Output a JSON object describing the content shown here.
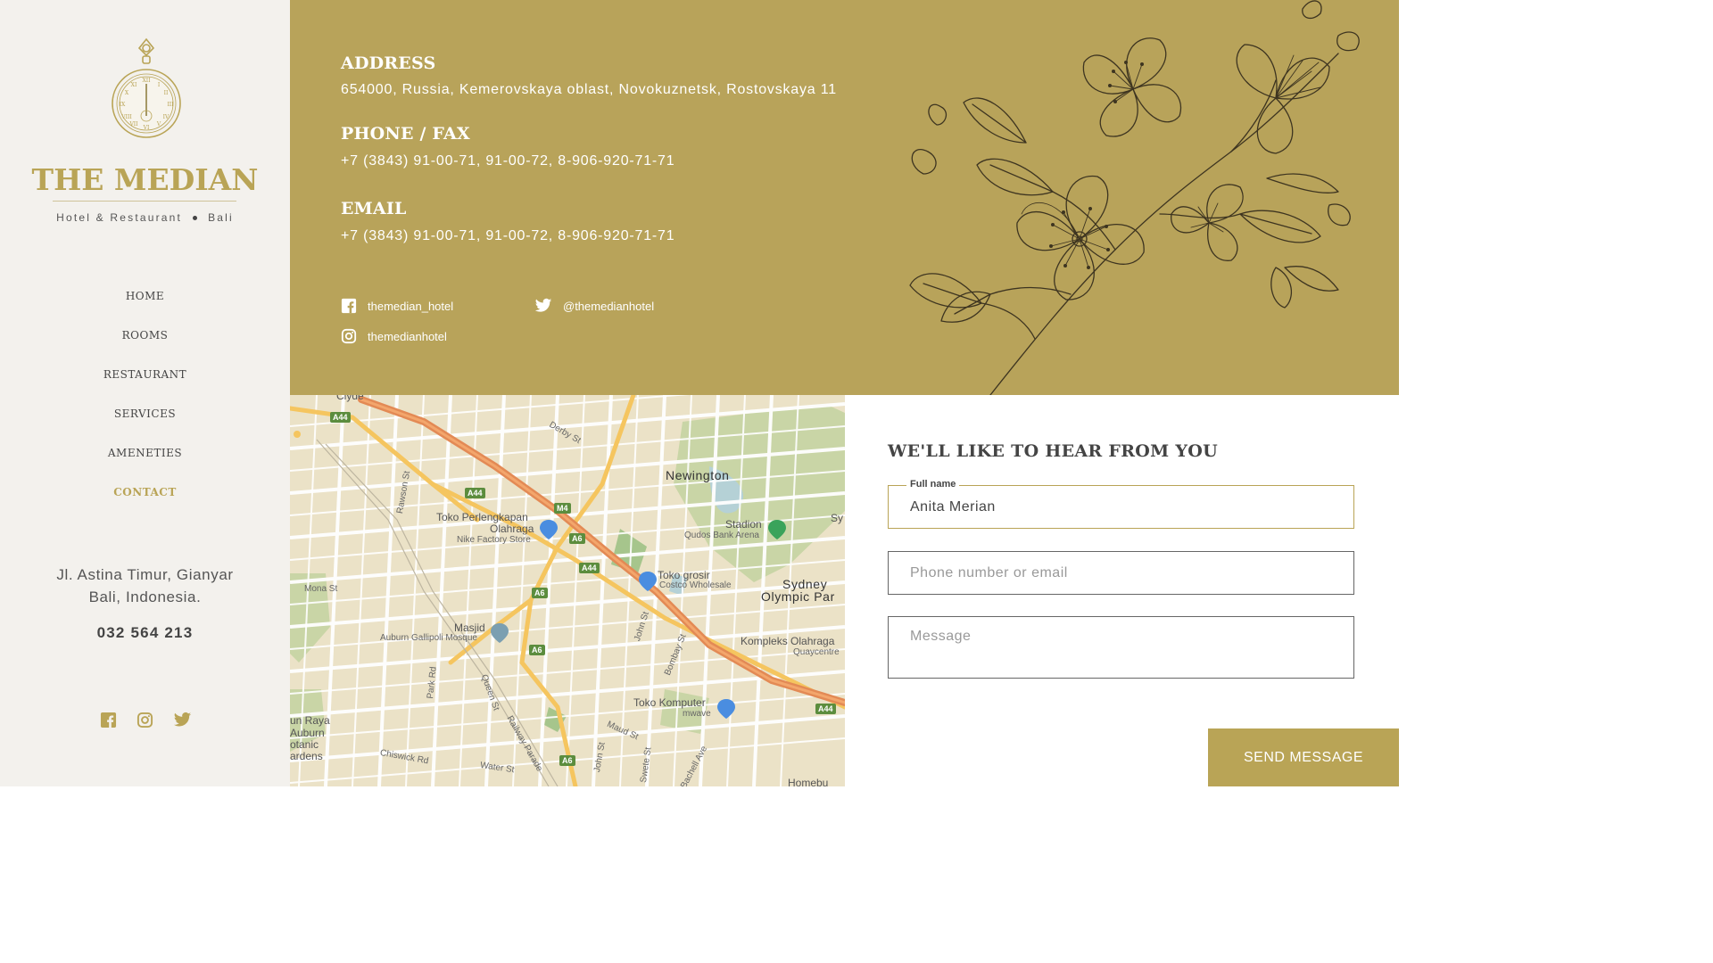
{
  "brand": {
    "name": "THE MEDIAN",
    "subtitle_left": "Hotel & Restaurant",
    "subtitle_right": "Bali",
    "accent_color": "#b9a456"
  },
  "nav": {
    "items": [
      {
        "label": "HOME",
        "active": false
      },
      {
        "label": "ROOMS",
        "active": false
      },
      {
        "label": "RESTAURANT",
        "active": false
      },
      {
        "label": "SERVICES",
        "active": false
      },
      {
        "label": "AMENETIES",
        "active": false
      },
      {
        "label": "CONTACT",
        "active": true
      }
    ]
  },
  "sidebar": {
    "address_line1": "Jl. Astina Timur, Gianyar",
    "address_line2": "Bali, Indonesia.",
    "phone": "032 564 213",
    "social_icons": [
      "facebook-icon",
      "instagram-icon",
      "twitter-icon"
    ]
  },
  "contact": {
    "address_label": "ADDRESS",
    "address_value": "654000, Russia, Kemerovskaya oblast, Novokuznetsk, Rostovskaya 11",
    "phone_label": "PHONE / FAX",
    "phone_value": "+7 (3843) 91-00-71, 91-00-72, 8-906-920-71-71",
    "email_label": "EMAIL",
    "email_value": "+7 (3843) 91-00-71, 91-00-72, 8-906-920-71-71",
    "facebook": "themedian_hotel",
    "twitter": "@themedianhotel",
    "instagram": "themedianhotel",
    "block_color": "#b8a35a"
  },
  "map": {
    "labels": {
      "clyde": "Clyde",
      "derby": "Derby St",
      "newington": "Newington",
      "rawson": "Rawson St",
      "toko1a": "Toko Perlengkapan",
      "toko1b": "Olahraga",
      "nike": "Nike Factory Store",
      "stadion": "Stadion",
      "qudos": "Qudos Bank Arena",
      "sydney1": "Sydney",
      "sydney2": "Olympic Par",
      "toko2": "Toko grosir",
      "costco": "Costco Wholesale",
      "mona": "Mona St",
      "masjid": "Masjid",
      "auburn_mosque": "Auburn Gallipoli Mosque",
      "john1": "John St",
      "bombay": "Bombay St",
      "kompleks": "Kompleks Olahraga",
      "quay": "Quaycentre",
      "park": "Park Rd",
      "queen": "Queen St",
      "railway": "Railway Parade",
      "toko3": "Toko Komputer",
      "jbhifi": "mwave",
      "maud": "Maud St",
      "auburn1": "un Raya",
      "auburn2": "Auburn",
      "auburn3": "otanic",
      "auburn4": "ardens",
      "chiswick": "Chiswick Rd",
      "water": "Water St",
      "john2": "John St",
      "swete": "Swete St",
      "bachell": "Bachell Ave",
      "homebush": "Homebu",
      "sy": "Sy"
    },
    "shields": [
      "A44",
      "A44",
      "M4",
      "A6",
      "A44",
      "A6",
      "A6",
      "A6",
      "A44"
    ]
  },
  "form": {
    "title": "WE'LL LIKE TO HEAR FROM YOU",
    "fullname_label": "Full name",
    "fullname_value": "Anita Merian",
    "contact_placeholder": "Phone number or email",
    "message_placeholder": "Message",
    "send_label": "SEND MESSAGE"
  }
}
